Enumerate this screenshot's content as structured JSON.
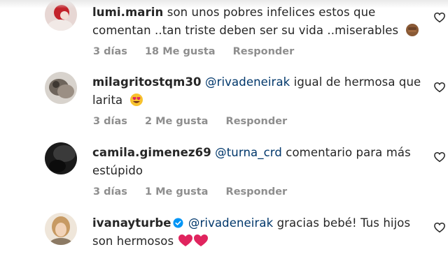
{
  "comments": [
    {
      "username": "lumi.marin",
      "text": "son unos pobres infelices estos que comentan ..tan triste deben ser su vida ..miserables",
      "emoji": "fist-emoji",
      "time": "3 días",
      "likes": "18 Me gusta",
      "reply": "Responder"
    },
    {
      "username": "milagritostqm30",
      "mention": "@rivadeneirak",
      "text": "igual de hermosa que larita",
      "emoji": "heart-eyes-emoji",
      "time": "3 días",
      "likes": "2 Me gusta",
      "reply": "Responder"
    },
    {
      "username": "camila.gimenez69",
      "mention": "@turna_crd",
      "text": "comentario para más estúpido",
      "time": "3 días",
      "likes": "1 Me gusta",
      "reply": "Responder"
    },
    {
      "username": "ivanayturbe",
      "verified": true,
      "mention": "@rivadeneirak",
      "text": "gracias bebé! Tus hijos son hermosos",
      "emoji": "red-heart-emoji",
      "time": "",
      "likes": "",
      "reply": ""
    }
  ],
  "colors": {
    "mention": "#00376b",
    "meta": "#8e8e8e",
    "verified": "#0095f6",
    "heart_emoji": "#e0245e"
  }
}
